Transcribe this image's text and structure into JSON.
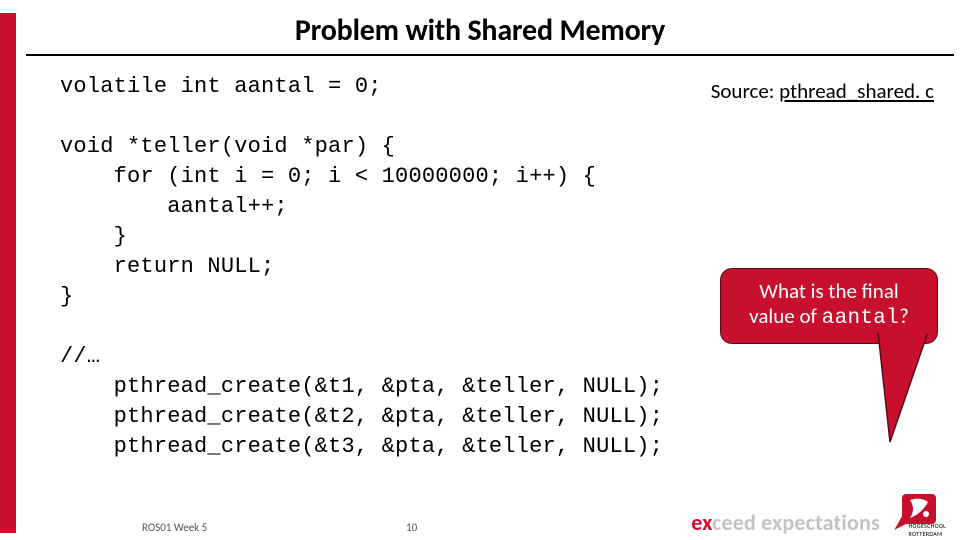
{
  "title": "Problem with Shared Memory",
  "source_label": "Source: ",
  "source_file": "pthread_shared. c",
  "code": {
    "l1": "volatile int aantal = 0;",
    "l2": "",
    "l3": "void *teller(void *par) {",
    "l4": "    for (int i = 0; i < 10000000; i++) {",
    "l5": "        aantal++;",
    "l6": "    }",
    "l7": "    return NULL;",
    "l8": "}",
    "l9": "",
    "l10": "//…",
    "l11": "    pthread_create(&t1, &pta, &teller, NULL);",
    "l12": "    pthread_create(&t2, &pta, &teller, NULL);",
    "l13": "    pthread_create(&t3, &pta, &teller, NULL);"
  },
  "callout": {
    "line1": "What is the final",
    "line2_a": "value of ",
    "line2_mono": "aantal",
    "line2_b": "?"
  },
  "footer": {
    "left": "ROS01 Week 5",
    "page": "10"
  },
  "brand": {
    "prefix": "ex",
    "mid": "ceed ",
    "suffix": "expectations",
    "school_top": "HOGESCHOOL",
    "school_bottom": "ROTTERDAM"
  }
}
